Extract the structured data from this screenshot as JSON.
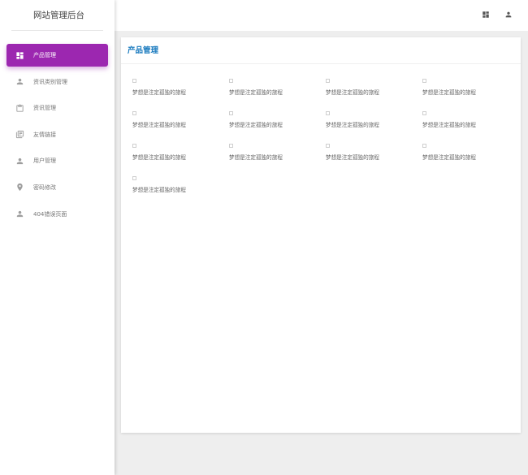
{
  "brand": {
    "title": "网站管理后台"
  },
  "topbar": {
    "icons": [
      "dashboard-icon",
      "person-icon"
    ]
  },
  "sidebar": {
    "items": [
      {
        "label": "产品管理",
        "icon": "dashboard-icon",
        "active": true
      },
      {
        "label": "资讯类别管理",
        "icon": "person-icon",
        "active": false
      },
      {
        "label": "资讯管理",
        "icon": "clipboard-icon",
        "active": false
      },
      {
        "label": "友情链接",
        "icon": "library-books-icon",
        "active": false
      },
      {
        "label": "用户管理",
        "icon": "person-icon",
        "active": false
      },
      {
        "label": "密码修改",
        "icon": "location-pin-icon",
        "active": false
      },
      {
        "label": "404错误页面",
        "icon": "person-icon",
        "active": false
      }
    ],
    "accent_color": "#9c27b0"
  },
  "main": {
    "card_title": "产品管理",
    "title_color": "#1a7bbf",
    "products": [
      {
        "name": "梦想是注定孤独的旅程"
      },
      {
        "name": "梦想是注定孤独的旅程"
      },
      {
        "name": "梦想是注定孤独的旅程"
      },
      {
        "name": "梦想是注定孤独的旅程"
      },
      {
        "name": "梦想是注定孤独的旅程"
      },
      {
        "name": "梦想是注定孤独的旅程"
      },
      {
        "name": "梦想是注定孤独的旅程"
      },
      {
        "name": "梦想是注定孤独的旅程"
      },
      {
        "name": "梦想是注定孤独的旅程"
      },
      {
        "name": "梦想是注定孤独的旅程"
      },
      {
        "name": "梦想是注定孤独的旅程"
      },
      {
        "name": "梦想是注定孤独的旅程"
      },
      {
        "name": "梦想是注定孤独的旅程"
      }
    ]
  }
}
